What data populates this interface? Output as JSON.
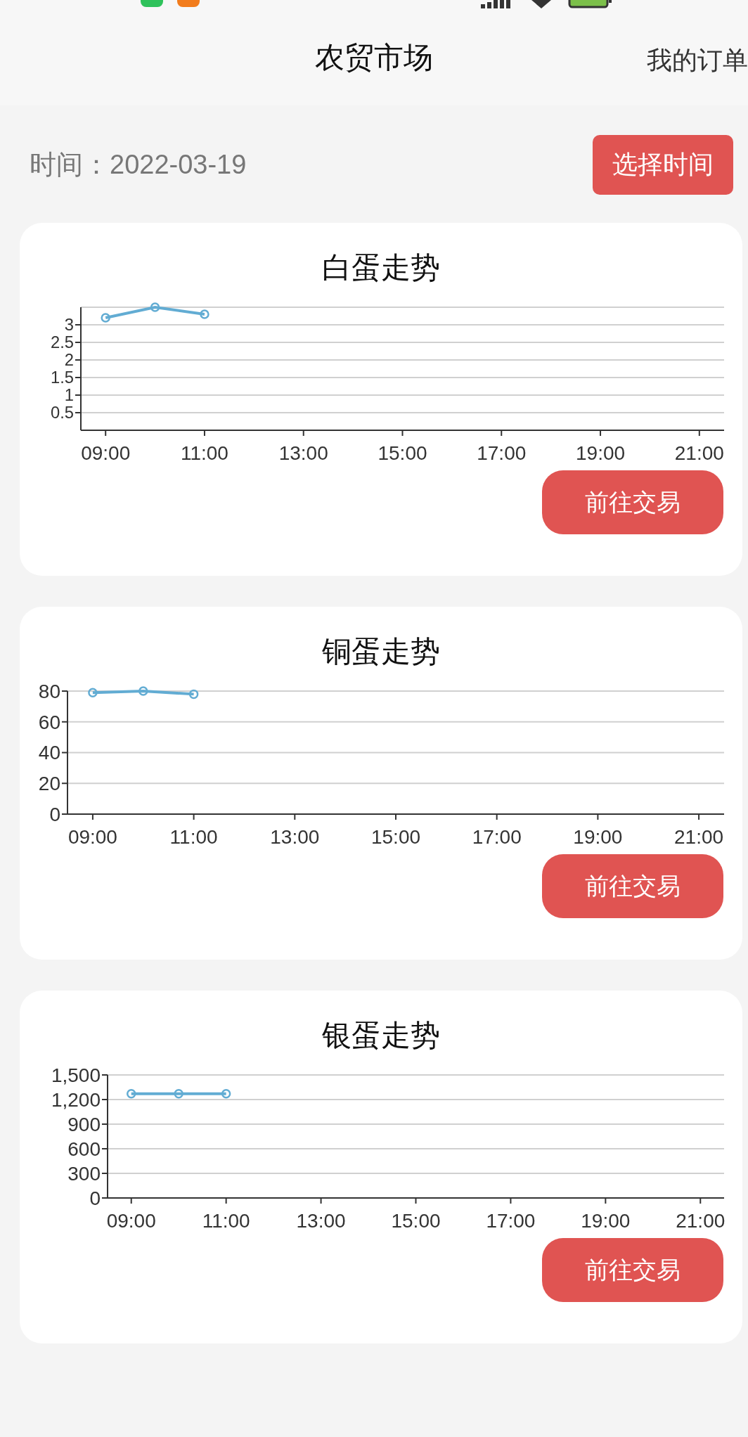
{
  "header": {
    "title": "农贸市场",
    "action": "我的订单"
  },
  "date_row": {
    "label": "时间：2022-03-19",
    "button": "选择时间"
  },
  "cards": [
    {
      "title": "白蛋走势",
      "button": "前往交易",
      "chart_data": {
        "type": "line",
        "x": [
          9,
          10,
          11
        ],
        "xlim": [
          8.5,
          21.5
        ],
        "xticks": [
          {
            "value": 9,
            "label": "09:00"
          },
          {
            "value": 11,
            "label": "11:00"
          },
          {
            "value": 13,
            "label": "13:00"
          },
          {
            "value": 15,
            "label": "15:00"
          },
          {
            "value": 17,
            "label": "17:00"
          },
          {
            "value": 19,
            "label": "19:00"
          },
          {
            "value": 21,
            "label": "21:00"
          }
        ],
        "ylim": [
          0,
          3.5
        ],
        "yticks": [
          {
            "value": 0.5,
            "label": "0.5"
          },
          {
            "value": 1,
            "label": "1"
          },
          {
            "value": 1.5,
            "label": "1.5"
          },
          {
            "value": 2,
            "label": "2"
          },
          {
            "value": 2.5,
            "label": "2.5"
          },
          {
            "value": 3,
            "label": "3"
          }
        ],
        "grid": true,
        "series": [
          {
            "color": "#62acd3",
            "marker": "circle",
            "values": [
              3.2,
              3.5,
              3.3
            ]
          }
        ]
      }
    },
    {
      "title": "铜蛋走势",
      "button": "前往交易",
      "chart_data": {
        "type": "line",
        "x": [
          9,
          10,
          11
        ],
        "xlim": [
          8.5,
          21.5
        ],
        "xticks": [
          {
            "value": 9,
            "label": "09:00"
          },
          {
            "value": 11,
            "label": "11:00"
          },
          {
            "value": 13,
            "label": "13:00"
          },
          {
            "value": 15,
            "label": "15:00"
          },
          {
            "value": 17,
            "label": "17:00"
          },
          {
            "value": 19,
            "label": "19:00"
          },
          {
            "value": 21,
            "label": "21:00"
          }
        ],
        "ylim": [
          0,
          80
        ],
        "yticks": [
          {
            "value": 0,
            "label": "0"
          },
          {
            "value": 20,
            "label": "20"
          },
          {
            "value": 40,
            "label": "40"
          },
          {
            "value": 60,
            "label": "60"
          },
          {
            "value": 80,
            "label": "80"
          }
        ],
        "grid": true,
        "series": [
          {
            "color": "#62acd3",
            "marker": "circle",
            "values": [
              79,
              80,
              78
            ]
          }
        ]
      }
    },
    {
      "title": "银蛋走势",
      "button": "前往交易",
      "chart_data": {
        "type": "line",
        "x": [
          9,
          10,
          11
        ],
        "xlim": [
          8.5,
          21.5
        ],
        "xticks": [
          {
            "value": 9,
            "label": "09:00"
          },
          {
            "value": 11,
            "label": "11:00"
          },
          {
            "value": 13,
            "label": "13:00"
          },
          {
            "value": 15,
            "label": "15:00"
          },
          {
            "value": 17,
            "label": "17:00"
          },
          {
            "value": 19,
            "label": "19:00"
          },
          {
            "value": 21,
            "label": "21:00"
          }
        ],
        "ylim": [
          0,
          1500
        ],
        "yticks": [
          {
            "value": 0,
            "label": "0"
          },
          {
            "value": 300,
            "label": "300"
          },
          {
            "value": 600,
            "label": "600"
          },
          {
            "value": 900,
            "label": "900"
          },
          {
            "value": 1200,
            "label": "1,200"
          },
          {
            "value": 1500,
            "label": "1,500"
          }
        ],
        "grid": true,
        "series": [
          {
            "color": "#62acd3",
            "marker": "circle",
            "values": [
              1270,
              1270,
              1270
            ]
          }
        ]
      }
    }
  ]
}
